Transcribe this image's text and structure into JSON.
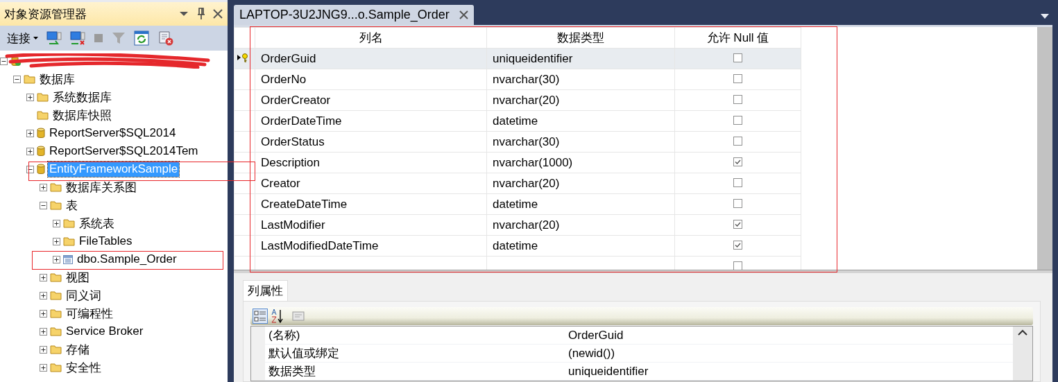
{
  "explorer": {
    "title": "对象资源管理器",
    "toolbar": {
      "connect_label": "连接"
    },
    "tree": [
      {
        "kind": "server",
        "label_redacted": true,
        "expandable": true,
        "expanded": true,
        "children": [
          {
            "kind": "folder",
            "label": "数据库",
            "expandable": true,
            "expanded": true,
            "selected": false,
            "children": [
              {
                "kind": "folder",
                "label": "系统数据库",
                "expandable": true,
                "expanded": false,
                "selected": false
              },
              {
                "kind": "folder",
                "label": "数据库快照",
                "expandable": false,
                "selected": false
              },
              {
                "kind": "database",
                "label": "ReportServer$SQL2014",
                "expandable": true,
                "expanded": false,
                "selected": false
              },
              {
                "kind": "database",
                "label": "ReportServer$SQL2014Tem",
                "expandable": true,
                "expanded": false,
                "selected": false
              },
              {
                "kind": "database",
                "label": "EntityFrameworkSample",
                "expandable": true,
                "expanded": true,
                "selected": true,
                "children": [
                  {
                    "kind": "folder",
                    "label": "数据库关系图",
                    "expandable": true,
                    "expanded": false,
                    "selected": false
                  },
                  {
                    "kind": "folder",
                    "label": "表",
                    "expandable": true,
                    "expanded": true,
                    "selected": false,
                    "children": [
                      {
                        "kind": "folder",
                        "label": "系统表",
                        "expandable": true,
                        "expanded": false,
                        "selected": false
                      },
                      {
                        "kind": "folder",
                        "label": "FileTables",
                        "expandable": true,
                        "expanded": false,
                        "selected": false
                      },
                      {
                        "kind": "table",
                        "label": "dbo.Sample_Order",
                        "expandable": true,
                        "expanded": false,
                        "selected": false
                      }
                    ]
                  },
                  {
                    "kind": "folder",
                    "label": "视图",
                    "expandable": true,
                    "expanded": false,
                    "selected": false
                  },
                  {
                    "kind": "folder",
                    "label": "同义词",
                    "expandable": true,
                    "expanded": false,
                    "selected": false
                  },
                  {
                    "kind": "folder",
                    "label": "可编程性",
                    "expandable": true,
                    "expanded": false,
                    "selected": false
                  },
                  {
                    "kind": "folder",
                    "label": "Service Broker",
                    "expandable": true,
                    "expanded": false,
                    "selected": false
                  },
                  {
                    "kind": "folder",
                    "label": "存储",
                    "expandable": true,
                    "expanded": false,
                    "selected": false
                  },
                  {
                    "kind": "folder",
                    "label": "安全性",
                    "expandable": true,
                    "expanded": false,
                    "selected": false
                  }
                ]
              }
            ]
          }
        ]
      }
    ]
  },
  "document_tab": {
    "label": "LAPTOP-3U2JNG9...o.Sample_Order",
    "selected": true
  },
  "table": {
    "columns": [
      "列名",
      "数据类型",
      "允许 Null 值"
    ],
    "rows": [
      {
        "kind": "column",
        "name": "OrderGuid",
        "type": "uniqueidentifier",
        "allow_null": false,
        "primary_key": true,
        "selected": true
      },
      {
        "kind": "column",
        "name": "OrderNo",
        "type": "nvarchar(30)",
        "allow_null": false,
        "primary_key": false,
        "selected": false
      },
      {
        "kind": "column",
        "name": "OrderCreator",
        "type": "nvarchar(20)",
        "allow_null": false,
        "primary_key": false,
        "selected": false
      },
      {
        "kind": "column",
        "name": "OrderDateTime",
        "type": "datetime",
        "allow_null": false,
        "primary_key": false,
        "selected": false
      },
      {
        "kind": "column",
        "name": "OrderStatus",
        "type": "nvarchar(30)",
        "allow_null": false,
        "primary_key": false,
        "selected": false
      },
      {
        "kind": "column",
        "name": "Description",
        "type": "nvarchar(1000)",
        "allow_null": true,
        "primary_key": false,
        "selected": false
      },
      {
        "kind": "column",
        "name": "Creator",
        "type": "nvarchar(20)",
        "allow_null": false,
        "primary_key": false,
        "selected": false
      },
      {
        "kind": "column",
        "name": "CreateDateTime",
        "type": "datetime",
        "allow_null": false,
        "primary_key": false,
        "selected": false
      },
      {
        "kind": "column",
        "name": "LastModifier",
        "type": "nvarchar(20)",
        "allow_null": true,
        "primary_key": false,
        "selected": false
      },
      {
        "kind": "column",
        "name": "LastModifiedDateTime",
        "type": "datetime",
        "allow_null": true,
        "primary_key": false,
        "selected": false
      },
      {
        "kind": "new",
        "allow_null": false,
        "selected": false
      }
    ]
  },
  "properties": {
    "tab": "列属性",
    "rows": [
      {
        "name": "(名称)",
        "value": "OrderGuid"
      },
      {
        "name": "默认值或绑定",
        "value": "(newid())"
      },
      {
        "name": "数据类型",
        "value": "uniqueidentifier"
      }
    ]
  }
}
